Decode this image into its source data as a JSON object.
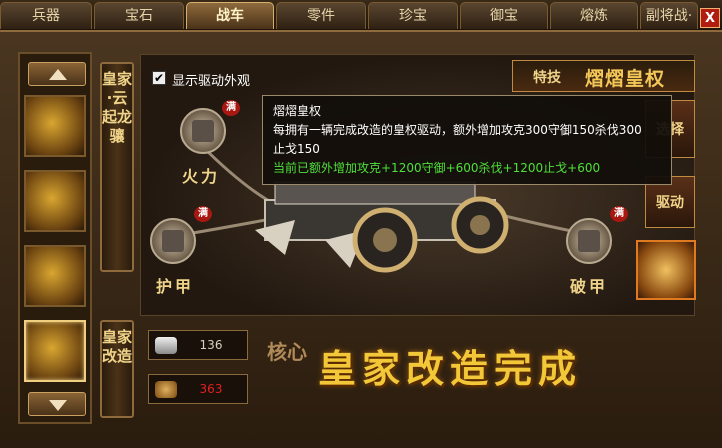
{
  "tabs": [
    {
      "label": "兵器"
    },
    {
      "label": "宝石"
    },
    {
      "label": "战车"
    },
    {
      "label": "零件"
    },
    {
      "label": "珍宝"
    },
    {
      "label": "御宝"
    },
    {
      "label": "熔炼"
    },
    {
      "label": "副将战·"
    }
  ],
  "active_tab": "战车",
  "close_label": "X",
  "chariot_name": "皇家·云起龙骧",
  "show_appearance_label": "显示驱动外观",
  "show_appearance_checked": true,
  "slots": {
    "firepower": {
      "label": "火力",
      "badge": "满"
    },
    "armor": {
      "label": "护甲",
      "badge": "满"
    },
    "breach": {
      "label": "破甲",
      "badge": "满"
    }
  },
  "skill": {
    "tag": "特技",
    "name": "熠熠皇权"
  },
  "tooltip": {
    "title": "熠熠皇权",
    "line1": "每拥有一辆完成改造的皇权驱动，额外增加攻克300守御150杀伐300",
    "line2": "止戈150",
    "current": "当前已额外增加攻克+1200守御+600杀伐+1200止戈+600"
  },
  "right_buttons": {
    "choose": "选择",
    "drive": "驱动"
  },
  "upgrade_banner": "皇家改造",
  "resources": [
    {
      "icon": "silver-ingot-icon",
      "value": "136",
      "color": "#d8d0c0"
    },
    {
      "icon": "gear-parts-icon",
      "value": "363",
      "color": "#e02020"
    }
  ],
  "core_label": "核心",
  "status_title": "皇家改造完成",
  "colors": {
    "accent": "#f2c838",
    "tooltip_green": "#4ee03a",
    "close_red": "#b01c10"
  }
}
